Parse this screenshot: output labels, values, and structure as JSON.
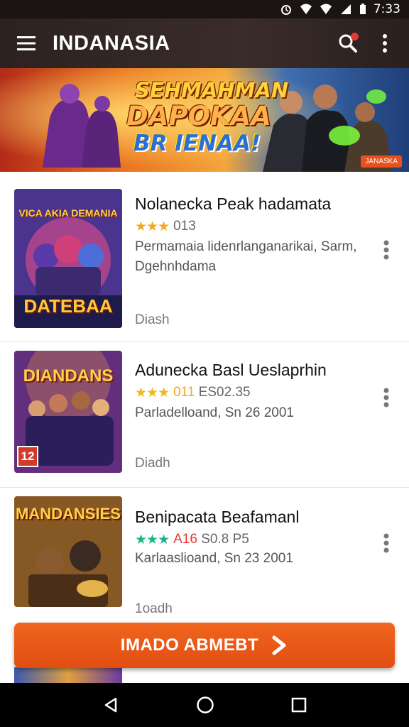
{
  "status_bar": {
    "time": "7:33",
    "icons": [
      "alarm-icon",
      "wifi-icon",
      "signal-icon",
      "battery-icon"
    ]
  },
  "app_bar": {
    "title": "INDANASIA",
    "icons": [
      "menu-icon",
      "search-icon",
      "more-vert-icon"
    ]
  },
  "banner": {
    "line1": "SEHMAHMAN",
    "line2": "DAPOKAA",
    "line3": "BR IENAA!",
    "badge": "JANASKA"
  },
  "items": [
    {
      "name": "Nolanecka Peak hadamata",
      "rating_text": "013",
      "stars": "★★★",
      "star_color": "#f2a81d",
      "desc": "Permamaia lidenrlanganarikai, Sarm, Dgehnhdama",
      "foot": "Diash",
      "thumb_title": "DATEBAA",
      "thumb_top": "VICA AKIA DEMANIA"
    },
    {
      "name": "Adunecka Basl Ueslaprhin",
      "rating_text": "011 ES02.35",
      "rating_highlight": "011",
      "stars": "★★★",
      "star_color": "#f2b81d",
      "desc": "Parladelloand, Sn 26 2001",
      "foot": "Diadh",
      "thumb_title": "DIANDANS",
      "thumb_badge": "12"
    },
    {
      "name": "Benipacata Beafamanl",
      "rating_text": "A16 S0.8 P5",
      "rating_highlight": "A16",
      "stars": "★★★",
      "star_color": "#1db588",
      "desc": "Karlaaslioand, Sn 23 2001",
      "foot": "1oadh",
      "thumb_title": "MANDANSIES"
    }
  ],
  "cta": {
    "label": "IMADO ABMEBT"
  },
  "colors": {
    "accent": "#e8561a",
    "appbar": "#2f2522",
    "highlight_red": "#e53935"
  }
}
